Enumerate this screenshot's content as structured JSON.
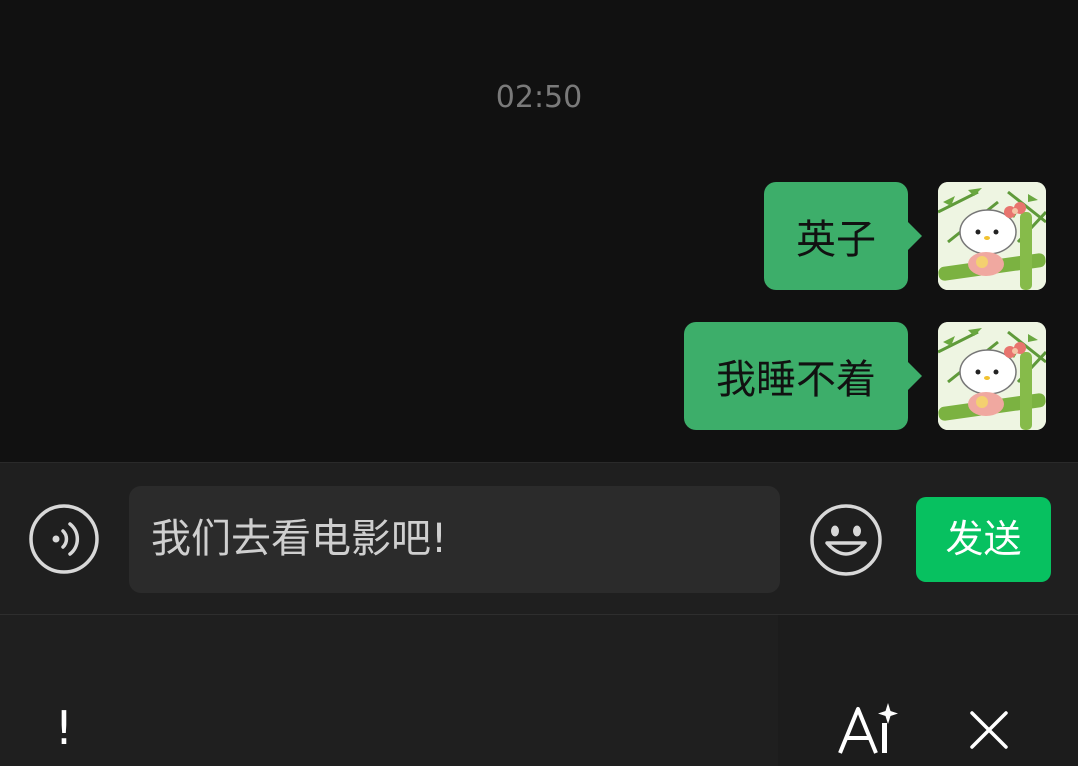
{
  "chat": {
    "timestamp": "02:50",
    "messages": [
      {
        "text": "英子",
        "sender": "self"
      },
      {
        "text": "我睡不着",
        "sender": "self"
      }
    ]
  },
  "input": {
    "value": "我们去看电影吧!",
    "send_label": "发送"
  },
  "keyboard": {
    "exclaim_label": "!"
  },
  "icons": {
    "voice": "voice-icon",
    "emoji": "emoji-icon",
    "ai": "ai-writing-icon",
    "close": "close-icon",
    "avatar": "hello-kitty-bamboo-avatar"
  },
  "colors": {
    "bubble": "#3dae6a",
    "send_button": "#07c160",
    "background": "#111111",
    "input_bar": "#1f1f1f"
  }
}
